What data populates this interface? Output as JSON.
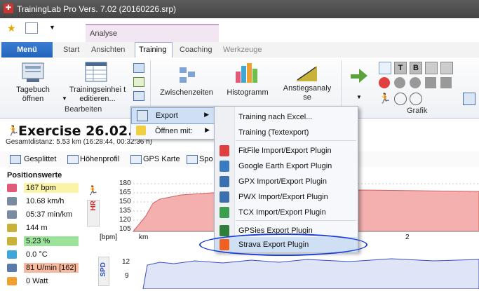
{
  "window": {
    "title": "TrainingLab Pro Vers. 7.02 (20160226.srp)"
  },
  "ribbon": {
    "context_tab": "Analyse",
    "menu_button": "Menü",
    "tabs": [
      "Start",
      "Ansichten",
      "Training",
      "Coaching",
      "Werkzeuge"
    ],
    "active_tab": "Training",
    "buttons": {
      "tagebuch": "Tagebuch öffnen",
      "trainingseinheit": "Trainingseinhei t editieren...",
      "zwischenzeiten": "Zwischenzeiten",
      "histogramm": "Histogramm",
      "anstieg": "Anstiegsanalyse"
    },
    "groups": {
      "bearbeiten": "Bearbeiten",
      "grafik": "Grafik"
    }
  },
  "exercise": {
    "title": "Exercise 26.02.",
    "distance": "Gesamtdistanz: 5.53 km (16:28:44, 00:32:36 h)"
  },
  "subtabs": [
    "Gesplittet",
    "Höhenprofil",
    "GPS Karte",
    "Spo"
  ],
  "positionswerte": {
    "heading": "Positionswerte",
    "rows": [
      {
        "value": "167 bpm",
        "icon": "heart-icon",
        "bg": "#fbf3a8"
      },
      {
        "value": "10.68 km/h",
        "icon": "speed-icon",
        "bg": ""
      },
      {
        "value": "05:37 min/km",
        "icon": "pace-icon",
        "bg": ""
      },
      {
        "value": "144 m",
        "icon": "altitude-icon",
        "bg": ""
      },
      {
        "value": "5.23 %",
        "icon": "slope-icon",
        "bg": "#9be39b"
      },
      {
        "value": "0.0 °C",
        "icon": "thermometer-icon",
        "bg": ""
      },
      {
        "value": "81 U/min [162]",
        "icon": "cadence-icon",
        "bg": "#f7b9a0"
      },
      {
        "value": "0 Watt",
        "icon": "power-icon",
        "bg": ""
      }
    ]
  },
  "chart": {
    "hr_label": "HR",
    "unit_label": "[bpm]",
    "x_unit": "km",
    "x_tick": "2",
    "y_ticks": [
      "180",
      "165",
      "150",
      "135",
      "120",
      "105"
    ],
    "spd_label": "SPD",
    "spd_ticks": [
      "12",
      "9"
    ]
  },
  "context_menu": {
    "items": [
      {
        "label": "Export",
        "has_submenu": true
      },
      {
        "label": "Öffnen mit:",
        "has_submenu": true
      }
    ]
  },
  "export_submenu": {
    "items": [
      {
        "label": "Training nach Excel...",
        "icon": "excel-icon"
      },
      {
        "label": "Training (Textexport)",
        "icon": "text-export-icon"
      },
      {
        "label": "FitFile Import/Export Plugin",
        "icon": "fitfile-icon"
      },
      {
        "label": "Google Earth Export Plugin",
        "icon": "google-earth-icon"
      },
      {
        "label": "GPX Import/Export Plugin",
        "icon": "gpx-icon"
      },
      {
        "label": "PWX Import/Export Plugin",
        "icon": "pwx-icon"
      },
      {
        "label": "TCX Import/Export Plugin",
        "icon": "tcx-icon"
      },
      {
        "label": "GPSies Export Plugin",
        "icon": "gpsies-icon"
      },
      {
        "label": "Strava Export Plugin",
        "icon": "strava-icon"
      }
    ]
  },
  "colors": {
    "menu_blue": "#2a6cc6",
    "highlight_ellipse": "#1b3fd6",
    "hr_fill": "#f3b0ae"
  }
}
